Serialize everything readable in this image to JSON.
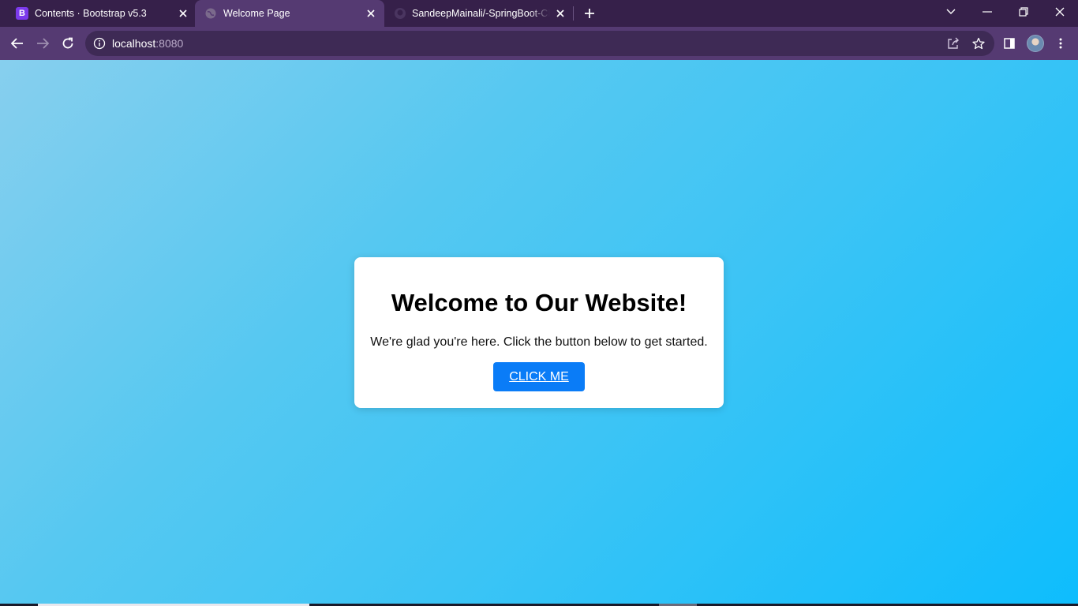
{
  "tabs": [
    {
      "title": "Contents · Bootstrap v5.3",
      "favicon": "bootstrap-icon",
      "favicon_letter": "B",
      "active": false
    },
    {
      "title": "Welcome Page",
      "favicon": "globe-icon",
      "active": true
    },
    {
      "title": "SandeepMainali/-SpringBoot-CRUD",
      "favicon": "github-icon",
      "active": false
    }
  ],
  "address_bar": {
    "host": "localhost",
    "port": ":8080"
  },
  "page": {
    "heading": "Welcome to Our Website!",
    "subtext": "We're glad you're here. Click the button below to get started.",
    "button_label": "CLICK ME"
  },
  "colors": {
    "tab_strip": "#36204a",
    "toolbar": "#553a72",
    "button": "#0a7cf7",
    "gradient_start": "#87cfee",
    "gradient_end": "#0ebdfd"
  }
}
